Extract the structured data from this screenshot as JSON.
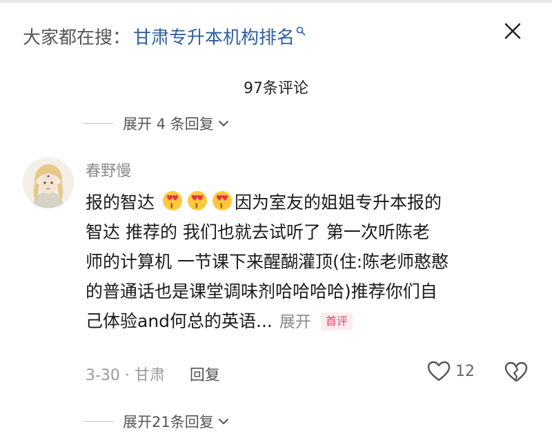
{
  "search": {
    "prefix": "大家都在搜：",
    "query": "甘肃专升本机构排名",
    "icon": "search-icon"
  },
  "comments_header": {
    "count_label": "97条评论"
  },
  "expand_top": {
    "label": "展开 4 条回复"
  },
  "comment": {
    "username": "春野慢",
    "line1_before": "报的智达 ",
    "line1_after": "因为室友的姐姐专升本报的",
    "line2": "智达 推荐的 我们也就去试听了  第一次听陈老",
    "line3": "师的计算机 一节课下来醒醐灌顶(住:陈老师憨憨",
    "line4": "的普通话也是课堂调味剂哈哈哈哈)推荐你们自",
    "line5": "己体验and何总的英语...",
    "inline_expand": "展开",
    "badge": "首评",
    "date_location": "3-30 · 甘肃",
    "reply_label": "回复",
    "like_count": "12",
    "emoji": "heart-eyes-kiss-emoji"
  },
  "expand_bottom": {
    "label": "展开21条回复"
  },
  "colors": {
    "query": "#2f5fa0",
    "badge_bg": "#fdebef",
    "badge_text": "#e0456b",
    "muted": "#8a8a8a"
  }
}
